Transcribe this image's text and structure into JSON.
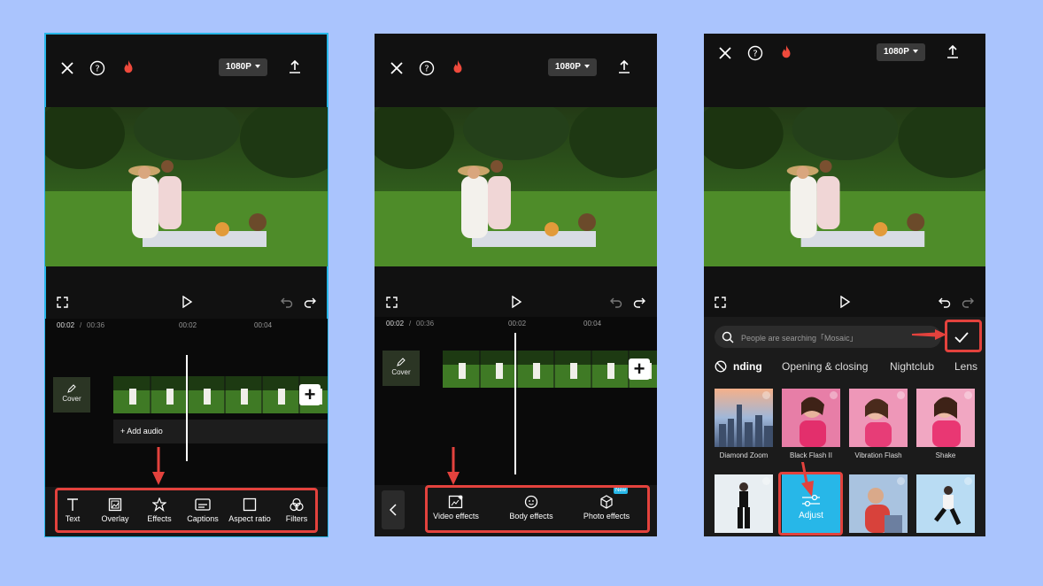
{
  "common": {
    "resolution": "1080P",
    "time_current": "00:02",
    "time_total": "00:36",
    "tick_1": "00:02",
    "tick_2": "00:04",
    "cover_label": "Cover"
  },
  "panel1": {
    "add_audio": "+ Add audio",
    "toolbar": [
      "Text",
      "Overlay",
      "Effects",
      "Captions",
      "Aspect ratio",
      "Filters"
    ]
  },
  "panel2": {
    "toolbar": [
      "Video effects",
      "Body effects",
      "Photo effects"
    ],
    "new_badge": "New"
  },
  "panel3": {
    "search_placeholder": "People are searching「Mosaic」",
    "categories": [
      "nding",
      "Opening & closing",
      "Nightclub",
      "Lens"
    ],
    "effects_row1": [
      "Diamond Zoom",
      "Black Flash II",
      "Vibration Flash",
      "Shake"
    ],
    "adjust_label": "Adjust"
  },
  "colors": {
    "background": "#aac4fd",
    "highlight": "#e3423d",
    "accent": "#27b7e8",
    "fire": "#ef4a3c"
  }
}
